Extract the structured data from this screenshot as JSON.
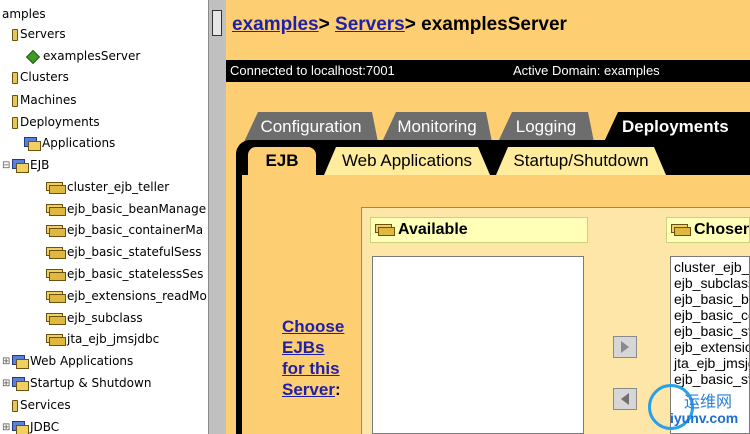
{
  "tree": {
    "root": "amples",
    "servers": "Servers",
    "examples_server": "examplesServer",
    "clusters": "Clusters",
    "machines": "Machines",
    "deployments": "Deployments",
    "applications": "Applications",
    "ejb": "EJB",
    "ejb_items": [
      "cluster_ejb_teller",
      "ejb_basic_beanManage",
      "ejb_basic_containerMa",
      "ejb_basic_statefulSess",
      "ejb_basic_statelessSes",
      "ejb_extensions_readMo",
      "ejb_subclass",
      "jta_ejb_jmsjdbc"
    ],
    "web_applications": "Web Applications",
    "startup_shutdown": "Startup & Shutdown",
    "services": "Services",
    "jdbc": "JDBC",
    "collapsed_marker": "⊞",
    "expanded_marker": "⊟"
  },
  "header": {
    "crumb_1": "examples",
    "crumb_2": "Servers",
    "crumb_current": "examplesServer",
    "separator": ">"
  },
  "status": {
    "connection": "Connected to localhost:7001",
    "domain": "Active Domain: examples"
  },
  "tabs": {
    "configuration": "Configuration",
    "monitoring": "Monitoring",
    "logging": "Logging",
    "deployments": "Deployments"
  },
  "subtabs": {
    "ejb": "EJB",
    "web_applications": "Web Applications",
    "startup_shutdown": "Startup/Shutdown"
  },
  "ejb_panel": {
    "choose_link_line1": "Choose",
    "choose_link_line2": "EJBs",
    "choose_link_line3": "for this",
    "choose_link_line4": "Server",
    "choose_link_colon": ":",
    "available_title": "Available",
    "chosen_title": "Chosen",
    "chosen_items": [
      "cluster_ejb_teller",
      "ejb_subclass",
      "ejb_basic_beanManaged",
      "ejb_basic_containerManaged",
      "ejb_basic_statefulSession",
      "ejb_extensions_readMostly",
      "jta_ejb_jmsjdbc",
      "ejb_basic_statelessSession"
    ]
  },
  "watermark": {
    "cn_text": "运维网",
    "url": "iyunv.com"
  },
  "colors": {
    "panel_bg": "#fdcf72",
    "link": "#1f1fa8",
    "tab_active": "#000000",
    "tab_inactive": "#6d6d6d"
  }
}
